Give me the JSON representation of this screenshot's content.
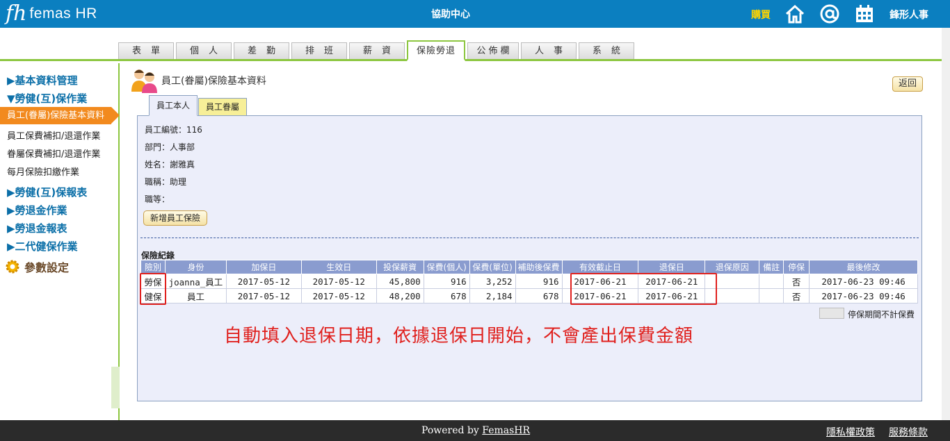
{
  "header": {
    "logo_mark": "fh",
    "logo_text": "femas HR",
    "center_title": "協助中心",
    "buy_label": "購買",
    "icons": [
      "home-icon",
      "at-icon",
      "calendar-icon"
    ],
    "user": "鋒形人事"
  },
  "top_tabs": [
    {
      "label": "表單"
    },
    {
      "label": "個人"
    },
    {
      "label": "差勤"
    },
    {
      "label": "排班"
    },
    {
      "label": "薪資"
    },
    {
      "label": "保險勞退",
      "active": true
    },
    {
      "label": "公佈欄"
    },
    {
      "label": "人事"
    },
    {
      "label": "系統"
    }
  ],
  "sidebar": {
    "groups": [
      "▶基本資料管理",
      "▼勞健(互)保作業"
    ],
    "active_item": "員工(眷屬)保險基本資料",
    "items": [
      "員工保費補扣/退還作業",
      "眷屬保費補扣/退還作業",
      "每月保險扣繳作業"
    ],
    "groups2": [
      "▶勞健(互)保報表",
      "▶勞退金作業",
      "▶勞退金報表",
      "▶二代健保作業"
    ],
    "param_label": "參數設定"
  },
  "page": {
    "title": "員工(眷屬)保險基本資料",
    "back_label": "返回",
    "subtabs": [
      "員工本人",
      "員工眷屬"
    ]
  },
  "employee": {
    "id_label": "員工編號：116",
    "dept_label": "部門：人事部",
    "name_label": "姓名：謝雅真",
    "title_label": "職稱：助理",
    "grade_label": "職等："
  },
  "add_button": "新增員工保險",
  "records": {
    "section_title": "保險紀錄",
    "columns": [
      "險別",
      "身份",
      "加保日",
      "生效日",
      "投保薪資",
      "保費(個人)",
      "保費(單位)",
      "補助後保費",
      "有效截止日",
      "退保日",
      "退保原因",
      "備註",
      "停保",
      "最後修改"
    ],
    "rows": [
      [
        "勞保",
        "joanna_員工",
        "2017-05-12",
        "2017-05-12",
        "45,800",
        "916",
        "3,252",
        "916",
        "2017-06-21",
        "2017-06-21",
        "",
        "",
        "否",
        "2017-06-23 09:46"
      ],
      [
        "健保",
        "員工",
        "2017-05-12",
        "2017-05-12",
        "48,200",
        "678",
        "2,184",
        "678",
        "2017-06-21",
        "2017-06-21",
        "",
        "",
        "否",
        "2017-06-23 09:46"
      ]
    ],
    "legend": "停保期間不計保費",
    "annotation": "自動填入退保日期，依據退保日開始，不會產出保費金額"
  },
  "footer": {
    "powered_prefix": "Powered by ",
    "powered_brand": "FemasHR",
    "privacy": "隱私權政策",
    "terms": "服務條款"
  },
  "colors": {
    "header": "#0b7fc0",
    "accent_green": "#8cc63f",
    "active_orange": "#f28a1e",
    "annotation_red": "#e0201d"
  }
}
